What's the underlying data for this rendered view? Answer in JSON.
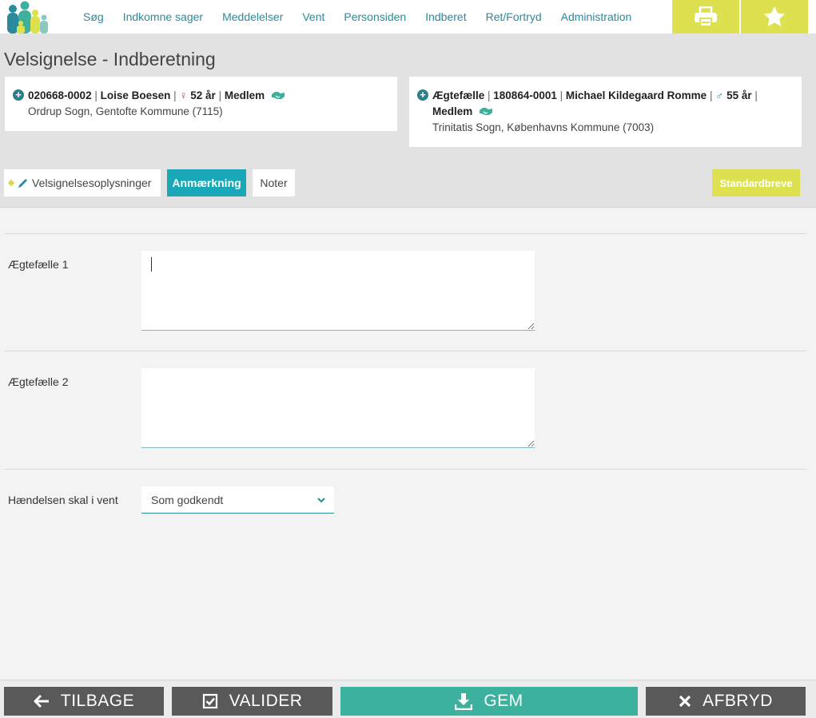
{
  "nav": {
    "items": [
      "Søg",
      "Indkomne sager",
      "Meddelelser",
      "Vent",
      "Personsiden",
      "Indberet",
      "Ret/Fortryd",
      "Administration"
    ]
  },
  "icons": {
    "print": "printer-icon",
    "favorite": "star-icon",
    "logo": "family-logo"
  },
  "colors": {
    "accent_teal": "#19a8b8",
    "accent_yellow": "#dde04f",
    "save_green": "#3cb19d",
    "dark_button": "#595959",
    "link": "#2a8b9c"
  },
  "page": {
    "title": "Velsignelse - Indberetning"
  },
  "person1": {
    "cpr": "020668-0002",
    "name": "Loise Boesen",
    "age": "52 år",
    "status": "Medlem",
    "address": "Ordrup Sogn, Gentofte Kommune (7115)"
  },
  "person2": {
    "role": "Ægtefælle",
    "cpr": "180864-0001",
    "name": "Michael Kildegaard Romme",
    "age": "55 år",
    "status": "Medlem",
    "address": "Trinitatis Sogn, Københavns Kommune (7003)"
  },
  "tabs": [
    {
      "label": "Velsignelsesoplysninger",
      "active": false
    },
    {
      "label": "Anmærkning",
      "active": true
    },
    {
      "label": "Noter",
      "active": false
    }
  ],
  "standard_letters": "Standardbreve",
  "form": {
    "spouse1_label": "Ægtefælle 1",
    "spouse1_value": "",
    "spouse2_label": "Ægtefælle 2",
    "spouse2_value": "",
    "wait_label": "Hændelsen skal i vent",
    "wait_value": "Som godkendt"
  },
  "actions": {
    "back": "TILBAGE",
    "validate": "VALIDER",
    "save": "GEM",
    "cancel": "AFBRYD"
  }
}
